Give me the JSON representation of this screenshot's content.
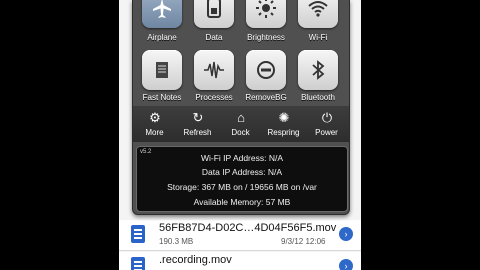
{
  "control_panel": {
    "row1": [
      {
        "label": "Airplane",
        "icon": "airplane-icon",
        "active": true
      },
      {
        "label": "Data",
        "icon": "sim-card-icon",
        "active": false
      },
      {
        "label": "Brightness",
        "icon": "sun-icon",
        "active": false
      },
      {
        "label": "Wi-Fi",
        "icon": "wifi-icon",
        "active": false
      }
    ],
    "row2": [
      {
        "label": "Fast Notes",
        "icon": "notes-icon"
      },
      {
        "label": "Processes",
        "icon": "waveform-icon"
      },
      {
        "label": "RemoveBG",
        "icon": "minus-circle-icon"
      },
      {
        "label": "Bluetooth",
        "icon": "bluetooth-icon"
      }
    ],
    "actions": [
      {
        "label": "More",
        "icon": "gear-icon"
      },
      {
        "label": "Refresh",
        "icon": "refresh-icon"
      },
      {
        "label": "Dock",
        "icon": "dock-icon"
      },
      {
        "label": "Respring",
        "icon": "respring-icon"
      },
      {
        "label": "Power",
        "icon": "power-icon"
      }
    ],
    "info": {
      "version": "v5.2",
      "wifi_ip": "Wi-Fi IP Address: N/A",
      "data_ip": "Data IP Address: N/A",
      "storage": "Storage: 367 MB on / 19656 MB on /var",
      "memory": "Available Memory: 57 MB"
    }
  },
  "file_list": [
    {
      "name": "56FB87D4-D02C…4D04F56F5.mov",
      "size": "190.3 MB",
      "date": "9/3/12 12:06"
    },
    {
      "name": ".recording.mov",
      "size": "",
      "date": ""
    }
  ],
  "colors": {
    "accent": "#2e68c8",
    "panel": "#505050"
  }
}
